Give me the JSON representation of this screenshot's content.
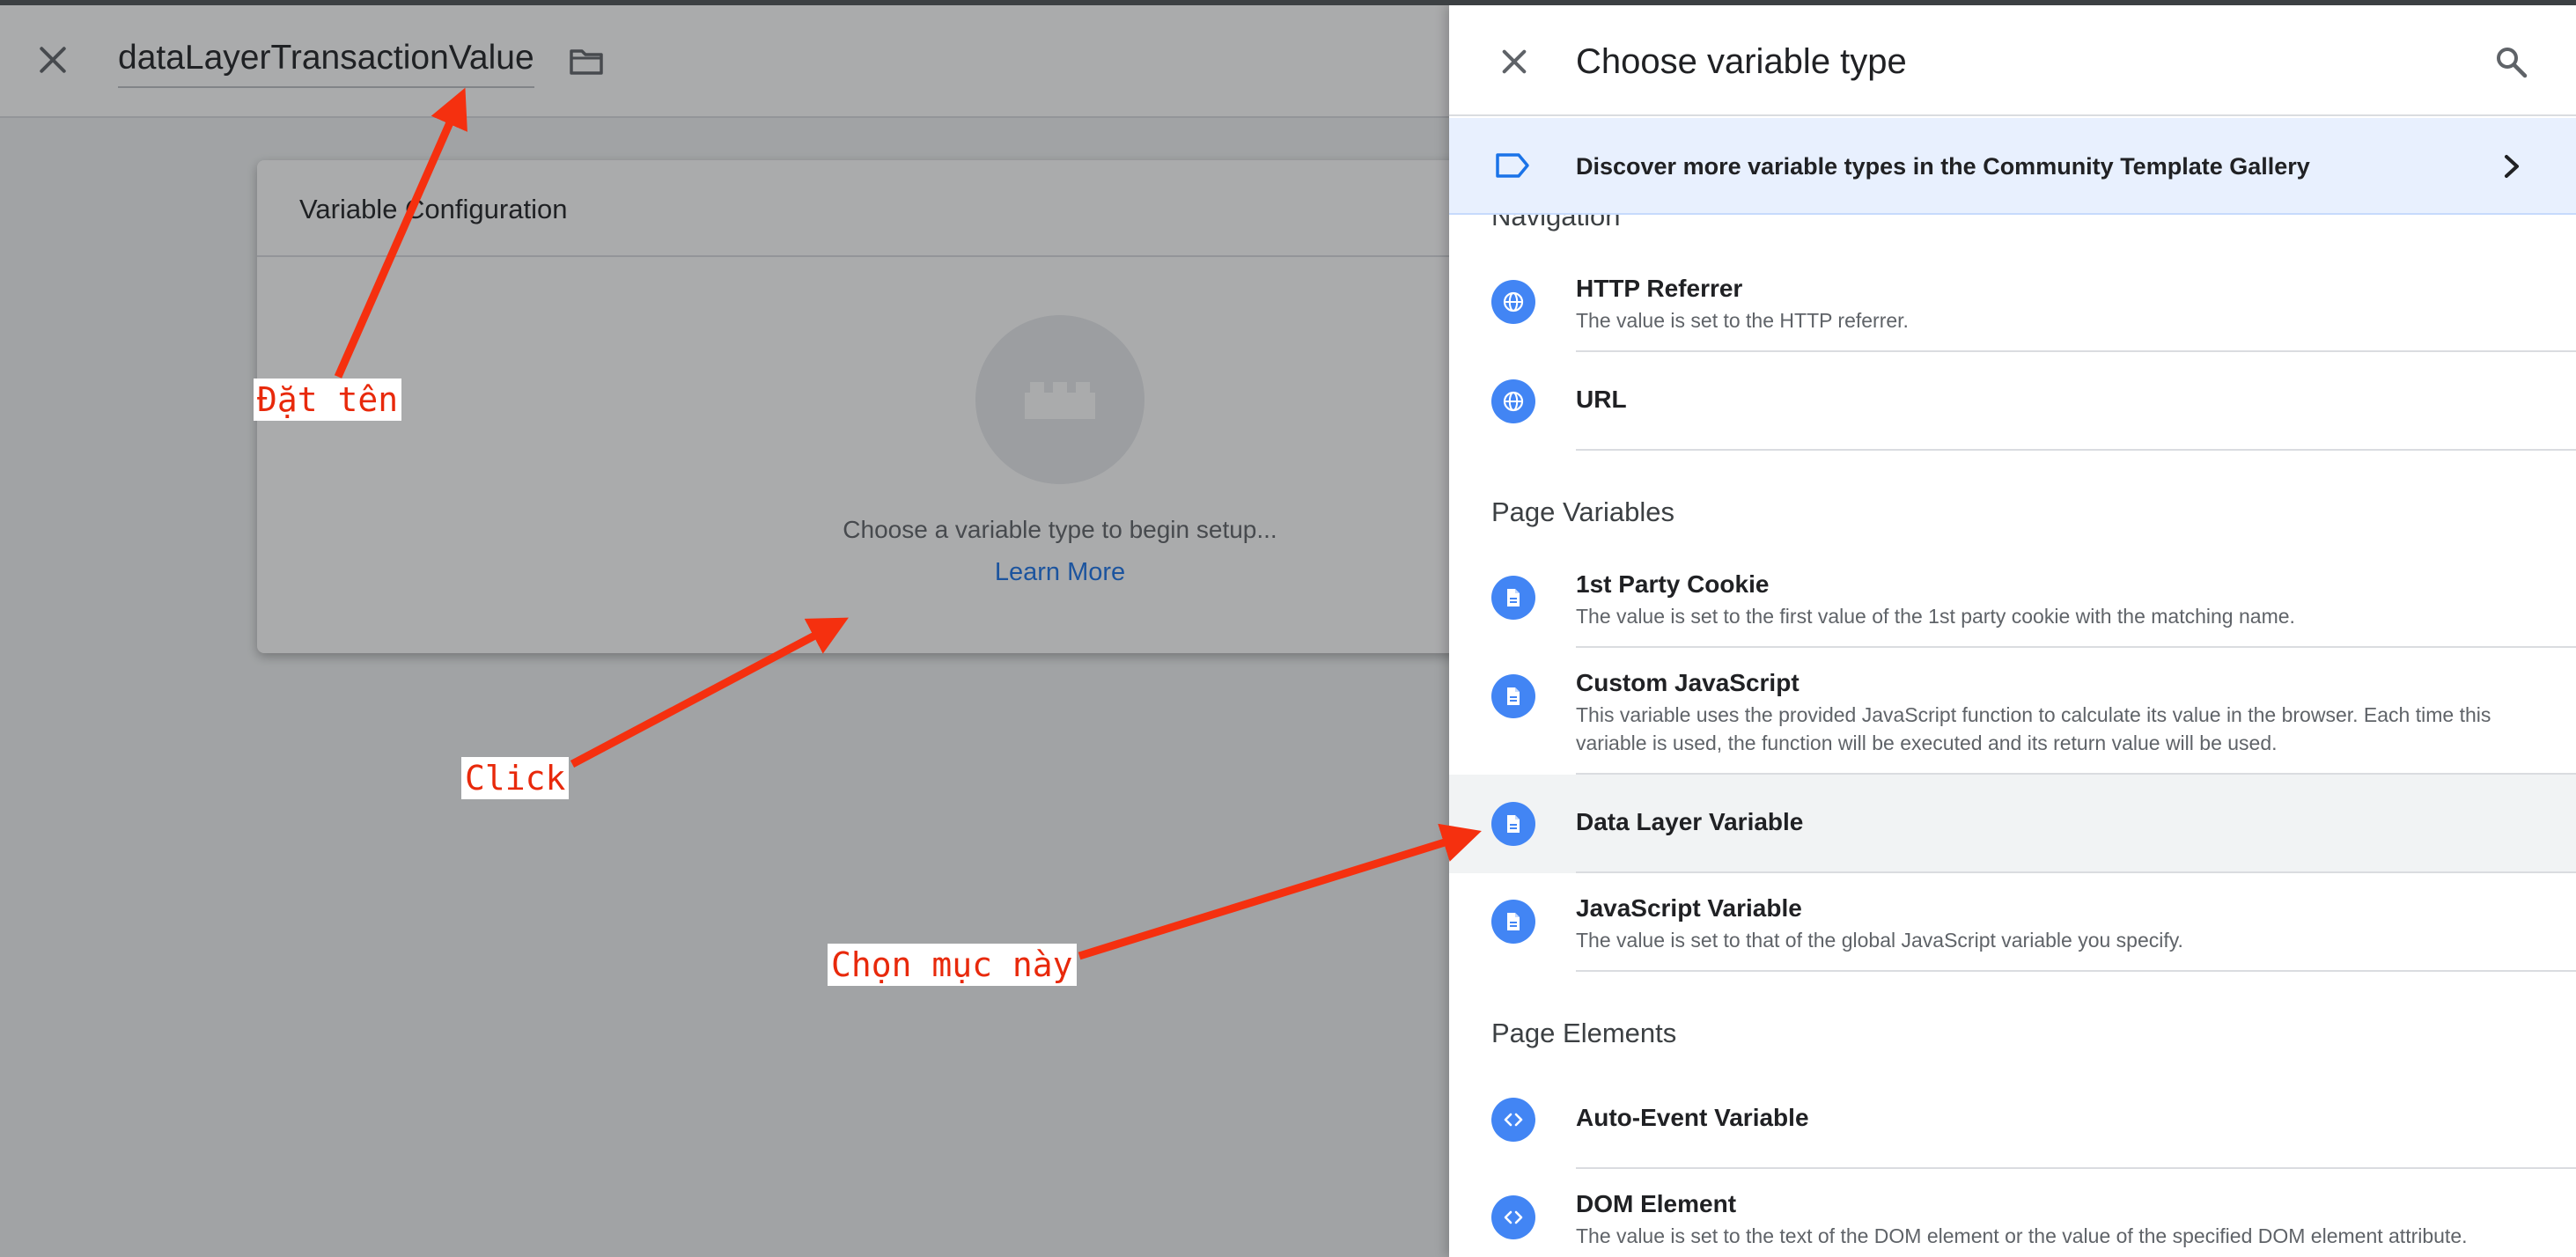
{
  "editor": {
    "variable_name": "dataLayerTransactionValue",
    "config": {
      "title": "Variable Configuration",
      "hint": "Choose a variable type to begin setup...",
      "learn_more": "Learn More"
    }
  },
  "panel": {
    "title": "Choose variable type",
    "banner": "Discover more variable types in the Community Template Gallery",
    "sections": [
      {
        "label": "Navigation",
        "items": [
          {
            "title": "HTTP Referrer",
            "desc": "The value is set to the HTTP referrer.",
            "icon": "globe-icon"
          },
          {
            "title": "URL",
            "desc": "",
            "icon": "globe-icon"
          }
        ]
      },
      {
        "label": "Page Variables",
        "items": [
          {
            "title": "1st Party Cookie",
            "desc": "The value is set to the first value of the 1st party cookie with the matching name.",
            "icon": "document-icon"
          },
          {
            "title": "Custom JavaScript",
            "desc": "This variable uses the provided JavaScript function to calculate its value in the browser. Each time this variable is used, the function will be executed and its return value will be used.",
            "icon": "document-icon"
          },
          {
            "title": "Data Layer Variable",
            "desc": "",
            "icon": "document-icon",
            "selected": true
          },
          {
            "title": "JavaScript Variable",
            "desc": "The value is set to that of the global JavaScript variable you specify.",
            "icon": "document-icon"
          }
        ]
      },
      {
        "label": "Page Elements",
        "items": [
          {
            "title": "Auto-Event Variable",
            "desc": "",
            "icon": "code-icon"
          },
          {
            "title": "DOM Element",
            "desc": "The value is set to the text of the DOM element or the value of the specified DOM element attribute.",
            "icon": "code-icon"
          }
        ]
      }
    ]
  },
  "annotations": {
    "name_label": "Đặt tên",
    "click_label": "Click",
    "choose_label": "Chọn mục này",
    "color": "#e8290b"
  }
}
